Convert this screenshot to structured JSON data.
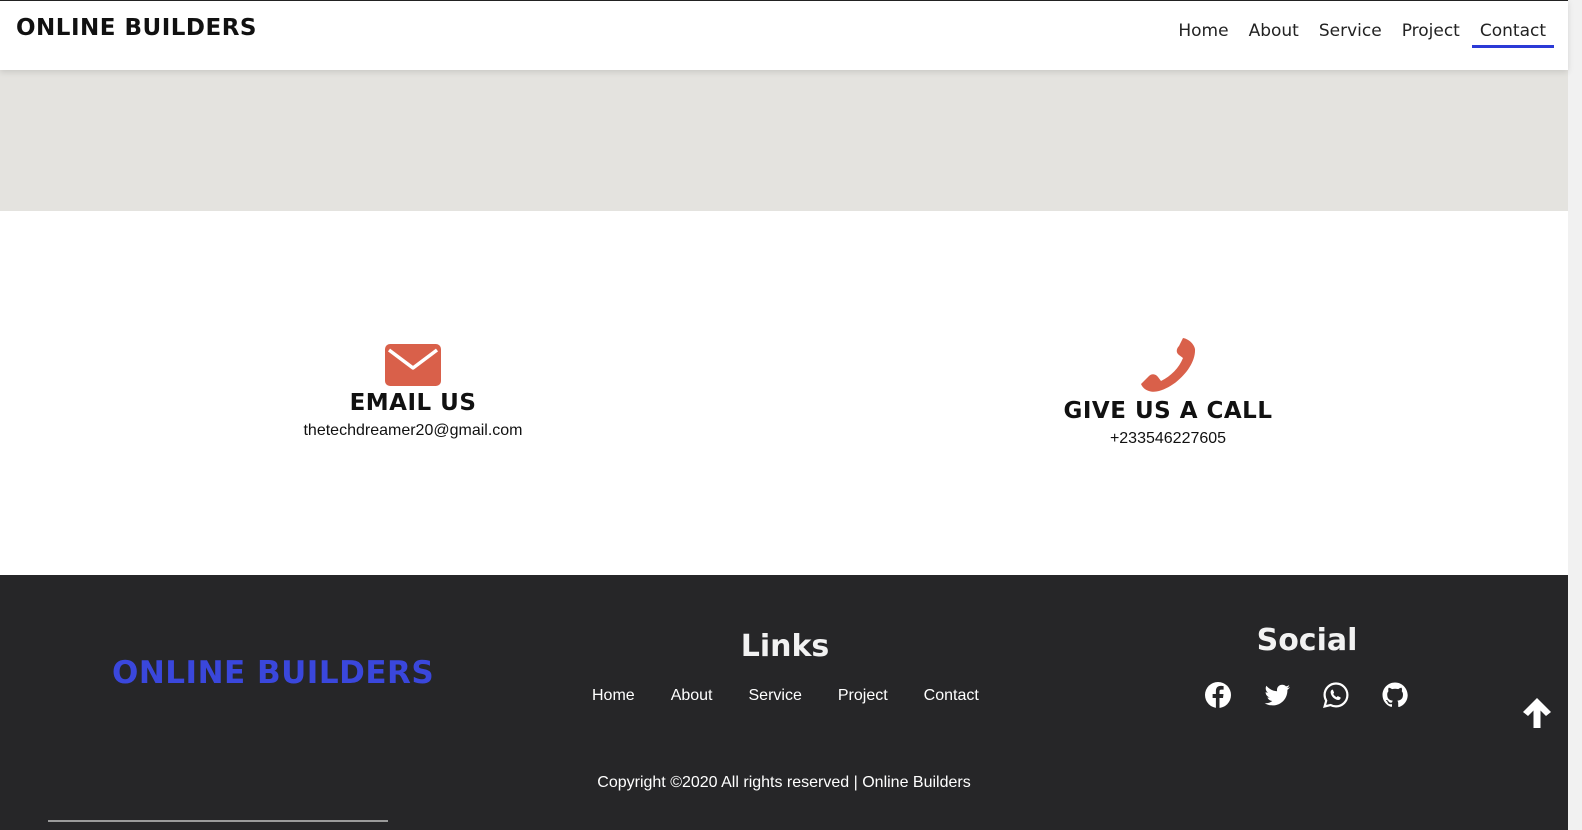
{
  "header": {
    "brand": "ONLINE BUILDERS",
    "nav": [
      {
        "label": "Home"
      },
      {
        "label": "About"
      },
      {
        "label": "Service"
      },
      {
        "label": "Project"
      },
      {
        "label": "Contact",
        "active": true
      }
    ]
  },
  "contact": {
    "email": {
      "icon": "envelope-icon",
      "title": "EMAIL US",
      "value": "thetechdreamer20@gmail.com"
    },
    "call": {
      "icon": "phone-icon",
      "title": "GIVE US A CALL",
      "value": "+233546227605"
    }
  },
  "footer": {
    "brand": "ONLINE BUILDERS",
    "links_title": "Links",
    "links": [
      "Home",
      "About",
      "Service",
      "Project",
      "Contact"
    ],
    "social_title": "Social",
    "social_icons": [
      "facebook-icon",
      "twitter-icon",
      "whatsapp-icon",
      "github-icon"
    ],
    "copyright": "Copyright ©2020 All rights reserved | Online Builders"
  },
  "colors": {
    "accent": "#2b3ad6",
    "footer_brand": "#3a47dc",
    "icon_orange": "#d9604a",
    "footer_bg": "#262628",
    "map_bg": "#e4e3df"
  }
}
